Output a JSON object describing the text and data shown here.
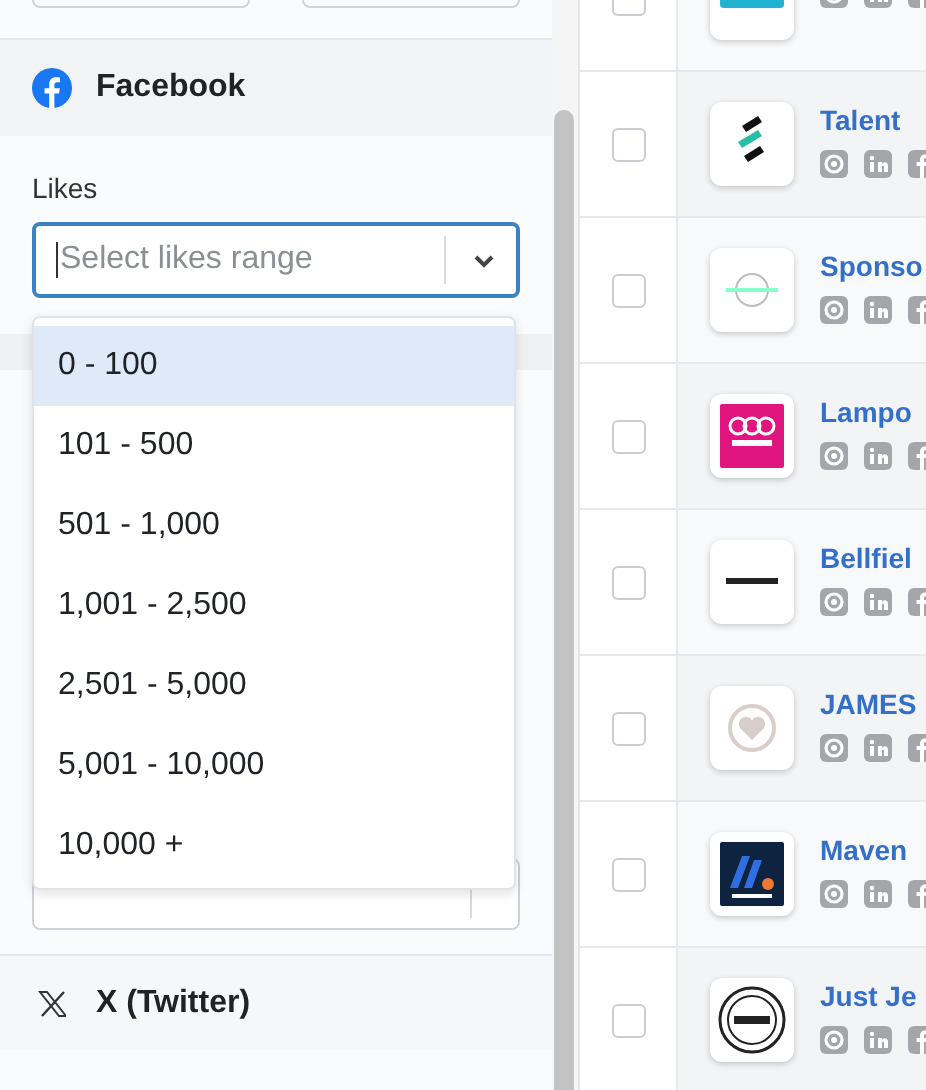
{
  "facebook": {
    "title": "Facebook",
    "likes": {
      "label": "Likes",
      "placeholder": "Select likes range",
      "focused": true,
      "expanded": true,
      "options": [
        {
          "label": "0 - 100",
          "selected": true
        },
        {
          "label": "101 - 500",
          "selected": false
        },
        {
          "label": "501 - 1,000",
          "selected": false
        },
        {
          "label": "1,001 - 2,500",
          "selected": false
        },
        {
          "label": "2,501 - 5,000",
          "selected": false
        },
        {
          "label": "5,001 - 10,000",
          "selected": false
        },
        {
          "label": "10,000 +",
          "selected": false
        }
      ]
    }
  },
  "twitter": {
    "title": "X (Twitter)"
  },
  "companies": [
    {
      "checked": false
    },
    {
      "name": "Talent",
      "checked": false
    },
    {
      "name": "Sponso",
      "checked": false
    },
    {
      "name": "Lampo",
      "checked": false
    },
    {
      "name": "Bellfiel",
      "checked": false
    },
    {
      "name": "JAMES",
      "checked": false
    },
    {
      "name": "Maven",
      "checked": false
    },
    {
      "name": "Just Je",
      "checked": false
    }
  ]
}
